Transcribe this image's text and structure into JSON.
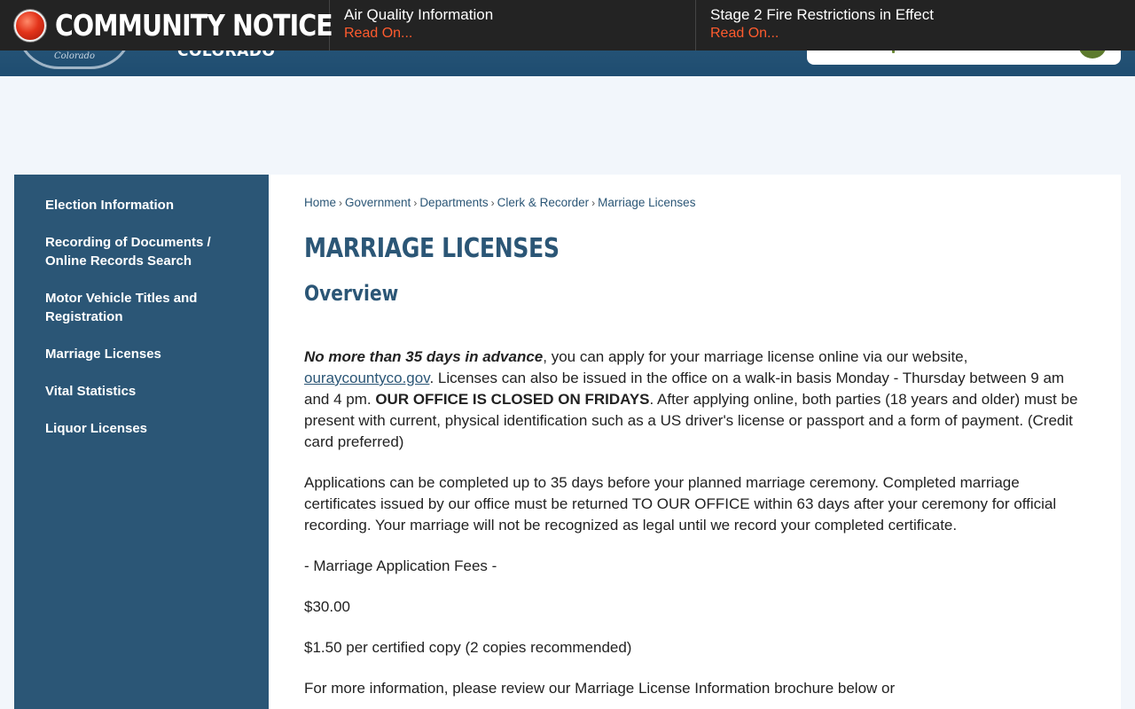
{
  "notice": {
    "title": "COMMUNITY NOTICE",
    "items": [
      {
        "title": "Air Quality Information",
        "link": "Read On..."
      },
      {
        "title": "Stage 2 Fire Restrictions in Effect",
        "link": "Read On..."
      }
    ]
  },
  "header": {
    "seal_text": "Colorado",
    "wordmark": "COLORADO"
  },
  "sidebar": {
    "items": [
      {
        "label": "Election Information"
      },
      {
        "label": "Recording of Documents / Online Records Search"
      },
      {
        "label": "Motor Vehicle Titles and Registration"
      },
      {
        "label": "Marriage Licenses"
      },
      {
        "label": "Vital Statistics"
      },
      {
        "label": "Liquor Licenses"
      }
    ]
  },
  "breadcrumb": [
    "Home",
    "Government",
    "Departments",
    "Clerk & Recorder",
    "Marriage Licenses"
  ],
  "breadcrumb_sep": "›",
  "page": {
    "title": "MARRIAGE LICENSES",
    "section": "Overview",
    "p1_bold_italic": "No more than 35 days in advance",
    "p1_a": ", you can apply for your marriage license online via our website, ",
    "p1_link": "ouraycountyco.gov",
    "p1_b": ". Licenses can also be issued in the office on a walk-in basis Monday - Thursday between 9 am and 4 pm. ",
    "p1_bold": "OUR OFFICE IS CLOSED ON FRIDAYS",
    "p1_c": ". After applying online, both parties (18 years and older) must be present with current, physical identification such as a US driver's license or passport and a form of payment. (Credit card preferred)",
    "p2": "Applications can be completed up to 35 days before your planned marriage ceremony. Completed marriage certificates issued by our office must be returned TO OUR OFFICE within 63 days after your ceremony for official recording. Your marriage will not be recognized as legal until we record your completed certificate.",
    "fees_heading": "- Marriage Application Fees -",
    "fee_amount": "$30.00",
    "fee_copy": "$1.50 per certified copy (2 copies recommended)",
    "p_more": "For more information, please review our Marriage License Information brochure below or"
  }
}
